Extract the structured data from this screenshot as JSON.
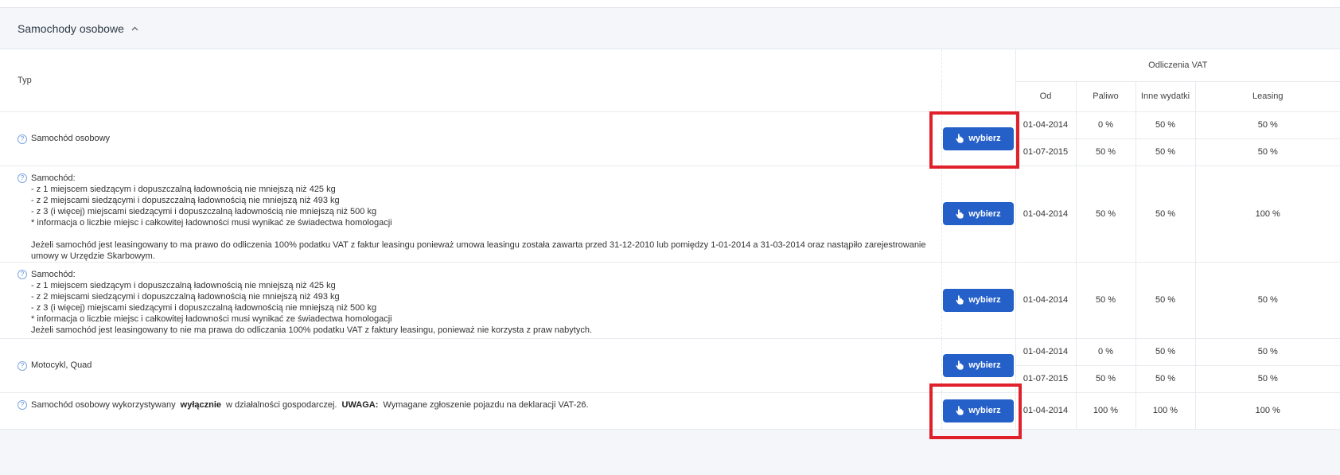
{
  "section": {
    "title": "Samochody osobowe"
  },
  "columns": {
    "typ": "Typ",
    "vat_group": "Odliczenia VAT",
    "od": "Od",
    "paliwo": "Paliwo",
    "inne": "Inne wydatki",
    "leasing": "Leasing"
  },
  "button_label": "wybierz",
  "rows": [
    {
      "description": "Samochód osobowy",
      "periods": [
        {
          "od": "01-04-2014",
          "paliwo": "0 %",
          "inne": "50 %",
          "leasing": "50 %"
        },
        {
          "od": "01-07-2015",
          "paliwo": "50 %",
          "inne": "50 %",
          "leasing": "50 %"
        }
      ]
    },
    {
      "description": "Samochód:\n- z 1 miejscem siedzącym i dopuszczalną ładownością nie mniejszą niż 425 kg\n- z 2 miejscami siedzącymi i dopuszczalną ładownością nie mniejszą niż 493 kg\n- z 3 (i więcej) miejscami siedzącymi i dopuszczalną ładownością nie mniejszą niż 500 kg\n* informacja o liczbie miejsc i całkowitej ładowności musi wynikać ze świadectwa homologacji\n\nJeżeli samochód jest leasingowany to ma prawo do odliczenia 100% podatku VAT z faktur leasingu ponieważ umowa leasingu została zawarta przed 31-12-2010 lub pomiędzy 1-01-2014 a 31-03-2014 oraz nastąpiło zarejestrowanie\numowy w Urzędzie Skarbowym.",
      "periods": [
        {
          "od": "01-04-2014",
          "paliwo": "50 %",
          "inne": "50 %",
          "leasing": "100 %"
        }
      ]
    },
    {
      "description": "Samochód:\n- z 1 miejscem siedzącym i dopuszczalną ładownością nie mniejszą niż 425 kg\n- z 2 miejscami siedzącymi i dopuszczalną ładownością nie mniejszą niż 493 kg\n- z 3 (i więcej) miejscami siedzącymi i dopuszczalną ładownością nie mniejszą niż 500 kg\n* informacja o liczbie miejsc i całkowitej ładowności musi wynikać ze świadectwa homologacji\nJeżeli samochód jest leasingowany to nie ma prawa do odliczania 100% podatku VAT z faktury leasingu, ponieważ nie korzysta z praw nabytych.",
      "periods": [
        {
          "od": "01-04-2014",
          "paliwo": "50 %",
          "inne": "50 %",
          "leasing": "50 %"
        }
      ]
    },
    {
      "description": "Motocykl, Quad",
      "periods": [
        {
          "od": "01-04-2014",
          "paliwo": "0 %",
          "inne": "50 %",
          "leasing": "50 %"
        },
        {
          "od": "01-07-2015",
          "paliwo": "50 %",
          "inne": "50 %",
          "leasing": "50 %"
        }
      ]
    },
    {
      "description_parts": [
        "Samochód osobowy wykorzystywany ",
        "wyłącznie",
        " w działalności gospodarczej. ",
        "UWAGA:",
        " Wymagane zgłoszenie pojazdu na deklaracji VAT-26."
      ],
      "periods": [
        {
          "od": "01-04-2014",
          "paliwo": "100 %",
          "inne": "100 %",
          "leasing": "100 %"
        }
      ]
    }
  ],
  "colors": {
    "button": "#2460c8",
    "highlight": "#e0212b",
    "help_icon": "#5a8fd8"
  }
}
